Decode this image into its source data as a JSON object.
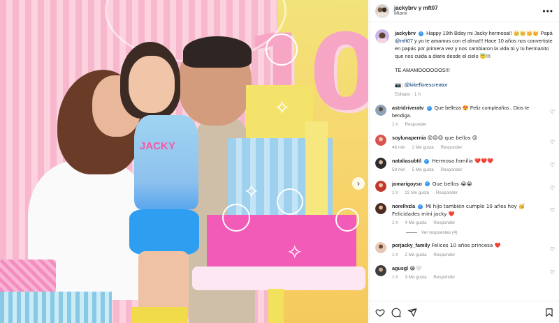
{
  "post": {
    "header": {
      "users": "jackybrv y mft07",
      "location": "Miami"
    },
    "caption": {
      "username": "jackybrv",
      "line1_text": "Happy 10th Bday mi Jacky hermosa!!",
      "line1_emojis": "👑👑👑👑",
      "line2_prefix": "Papá ",
      "line2_mention": "@mft07",
      "line2_text": " y yo te amamos con el alma!!! Hace 10 años nos convertiste en papás por primera vez y nos cambiaron la vida tú y tu hermanito que nos cuida a diario desde el cielo 😇!!!",
      "line3": "TE AMAMOOOOOOS!!!",
      "credit_emoji": "📷:",
      "credit_mention": "@kikeflorescreator",
      "status": "Editado · 1 h"
    },
    "comments": [
      {
        "username": "astridriveratv",
        "verified": true,
        "text": "Que belleza 😍 Feliz cumpleaños , Dios te bendiga.",
        "time": "1 h",
        "likes": "",
        "reply": "Responder"
      },
      {
        "username": "soylunapernia",
        "verified": false,
        "text": "😍😍😍 que bellos 😍",
        "time": "46 min",
        "likes": "2 Me gusta",
        "reply": "Responder"
      },
      {
        "username": "nataliasubtil",
        "verified": true,
        "text": "Hermosa familia ❤️❤️❤️",
        "time": "59 min",
        "likes": "5 Me gusta",
        "reply": "Responder"
      },
      {
        "username": "jomarigoyso",
        "verified": true,
        "text": "Que bellos 😭😭",
        "time": "1 h",
        "likes": "22 Me gusta",
        "reply": "Responder"
      },
      {
        "username": "norellvzla",
        "verified": true,
        "text": "Mi hijo también cumple 10 años hoy 🥳 Felicidades mini jacky ❤️",
        "time": "1 h",
        "likes": "4 Me gusta",
        "reply": "Responder",
        "view_replies": "Ver respuestas (4)"
      },
      {
        "username": "porjacky_family",
        "verified": false,
        "text": "Felices 10 años princesa ❤️",
        "time": "1 h",
        "likes": "2 Me gusta",
        "reply": "Responder"
      },
      {
        "username": "agusgl",
        "verified": false,
        "text": "😭🤍",
        "time": "1 h",
        "likes": "3 Me gusta",
        "reply": "Responder"
      }
    ]
  },
  "photo": {
    "jersey_text": "JACKY",
    "wall_number": "10"
  },
  "icons": {
    "more": "more-options-icon",
    "like": "heart-icon",
    "comment": "comment-icon",
    "share": "share-icon",
    "save": "bookmark-icon"
  },
  "colors": {
    "verified": "#3897f0",
    "mention": "#00376b",
    "meta": "#8e8e8e"
  }
}
